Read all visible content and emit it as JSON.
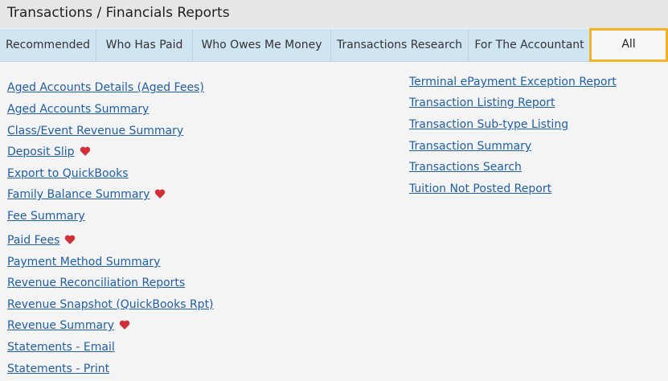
{
  "page": {
    "title": "Transactions / Financials Reports"
  },
  "tabs": [
    {
      "label": "Recommended"
    },
    {
      "label": "Who Has Paid"
    },
    {
      "label": "Who Owes Me Money"
    },
    {
      "label": "Transactions Research"
    },
    {
      "label": "For The Accountant"
    },
    {
      "label": "All",
      "active": true
    }
  ],
  "left_reports": [
    {
      "label": "Aged Accounts Details (Aged Fees)",
      "favorite": false
    },
    {
      "label": "Aged Accounts Summary",
      "favorite": false
    },
    {
      "label": "Class/Event Revenue Summary",
      "favorite": false
    },
    {
      "label": "Deposit Slip",
      "favorite": true
    },
    {
      "label": "Export to QuickBooks",
      "favorite": false
    },
    {
      "label": "Family Balance Summary",
      "favorite": true
    },
    {
      "label": "Fee Summary",
      "favorite": false
    },
    {
      "label": "Paid Fees",
      "favorite": true
    },
    {
      "label": "Payment Method Summary",
      "favorite": false
    },
    {
      "label": "Revenue Reconciliation Reports",
      "favorite": false
    },
    {
      "label": "Revenue Snapshot (QuickBooks Rpt)",
      "favorite": false
    },
    {
      "label": "Revenue Summary",
      "favorite": true
    },
    {
      "label": "Statements - Email",
      "favorite": false
    },
    {
      "label": "Statements - Print",
      "favorite": false
    }
  ],
  "right_reports": [
    {
      "label": "Terminal ePayment Exception Report",
      "favorite": false
    },
    {
      "label": "Transaction Listing Report",
      "favorite": false
    },
    {
      "label": "Transaction Sub-type Listing",
      "favorite": false
    },
    {
      "label": "Transaction Summary",
      "favorite": false
    },
    {
      "label": "Transactions Search",
      "favorite": false
    },
    {
      "label": "Tuition Not Posted Report",
      "favorite": false
    }
  ],
  "colors": {
    "link": "#1f5fa8",
    "heart": "#d12f3a",
    "active_tab_border": "#f0b429",
    "tab_bg": "#cfe5f2"
  },
  "icons": {
    "favorite": "heart-icon"
  }
}
